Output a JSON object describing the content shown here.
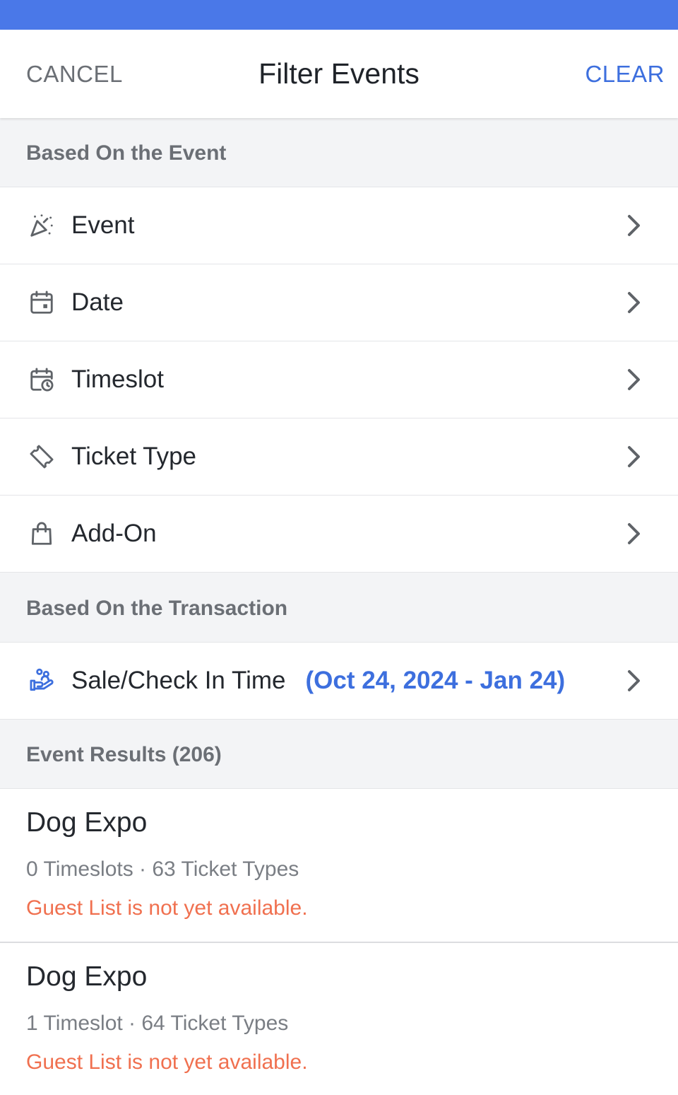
{
  "colors": {
    "status_bar": "#4a78e8",
    "accent": "#3d6fde",
    "warning": "#f0704f",
    "section_bg": "#f3f4f6"
  },
  "header": {
    "cancel_label": "CANCEL",
    "title": "Filter Events",
    "clear_label": "CLEAR"
  },
  "event_section": {
    "title": "Based On the Event",
    "items": [
      {
        "label": "Event",
        "icon": "party-popper-icon"
      },
      {
        "label": "Date",
        "icon": "calendar-icon"
      },
      {
        "label": "Timeslot",
        "icon": "calendar-clock-icon"
      },
      {
        "label": "Ticket Type",
        "icon": "ticket-icon"
      },
      {
        "label": "Add-On",
        "icon": "shopping-bag-icon"
      }
    ]
  },
  "transaction_section": {
    "title": "Based On the Transaction",
    "items": [
      {
        "label": "Sale/Check In Time",
        "value": "(Oct 24, 2024 - Jan 24)",
        "icon": "hand-people-icon"
      }
    ]
  },
  "results": {
    "title": "Event Results (206)",
    "items": [
      {
        "name": "Dog Expo",
        "meta": "0 Timeslots · 63 Ticket Types",
        "status": "Guest List is not yet available."
      },
      {
        "name": "Dog Expo",
        "meta": "1 Timeslot · 64 Ticket Types",
        "status": "Guest List is not yet available."
      }
    ]
  }
}
